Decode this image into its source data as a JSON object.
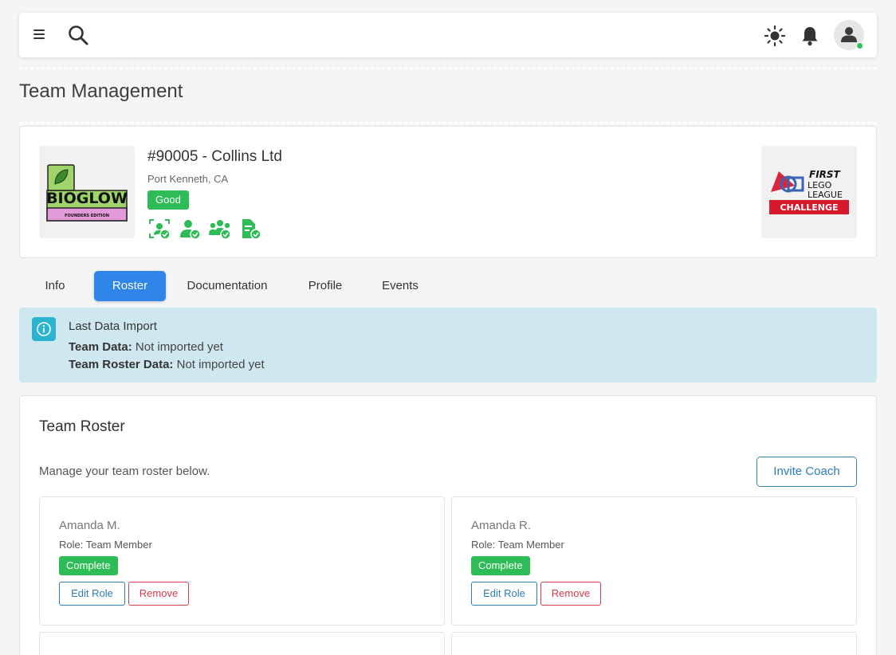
{
  "colors": {
    "primary": "#2f86e8",
    "success": "#2ebc57",
    "danger": "#d6394c",
    "info_bg": "#cfe8ef",
    "info_icon": "#2bb3cf"
  },
  "header": {
    "icons": [
      "menu-icon",
      "search-icon",
      "theme-toggle-sun-icon",
      "notification-bell-icon",
      "user-avatar-icon"
    ]
  },
  "page": {
    "title": "Team Management"
  },
  "team": {
    "number_name": "#90005 - Collins Ltd",
    "location": "Port Kenneth, CA",
    "status": "Good",
    "logo_text": "BIOGLOW",
    "logo_subtext": "FOUNDERS EDITION",
    "program_logo": {
      "line1": "FIRST",
      "line2": "LEGO",
      "line3": "LEAGUE",
      "banner": "CHALLENGE"
    },
    "status_icons": [
      "face-check-icon",
      "person-check-icon",
      "group-check-icon",
      "document-check-icon"
    ]
  },
  "tabs": [
    {
      "label": "Info",
      "active": false
    },
    {
      "label": "Roster",
      "active": true
    },
    {
      "label": "Documentation",
      "active": false
    },
    {
      "label": "Profile",
      "active": false
    },
    {
      "label": "Events",
      "active": false
    }
  ],
  "import_alert": {
    "title": "Last Data Import",
    "team_data_label": "Team Data:",
    "team_data_value": "Not imported yet",
    "roster_data_label": "Team Roster Data:",
    "roster_data_value": "Not imported yet"
  },
  "roster": {
    "title": "Team Roster",
    "description": "Manage your team roster below.",
    "invite_label": "Invite Coach",
    "members": [
      {
        "name": "Amanda M.",
        "role": "Role: Team Member",
        "status": "Complete",
        "edit_label": "Edit Role",
        "remove_label": "Remove"
      },
      {
        "name": "Amanda R.",
        "role": "Role: Team Member",
        "status": "Complete",
        "edit_label": "Edit Role",
        "remove_label": "Remove"
      }
    ]
  }
}
